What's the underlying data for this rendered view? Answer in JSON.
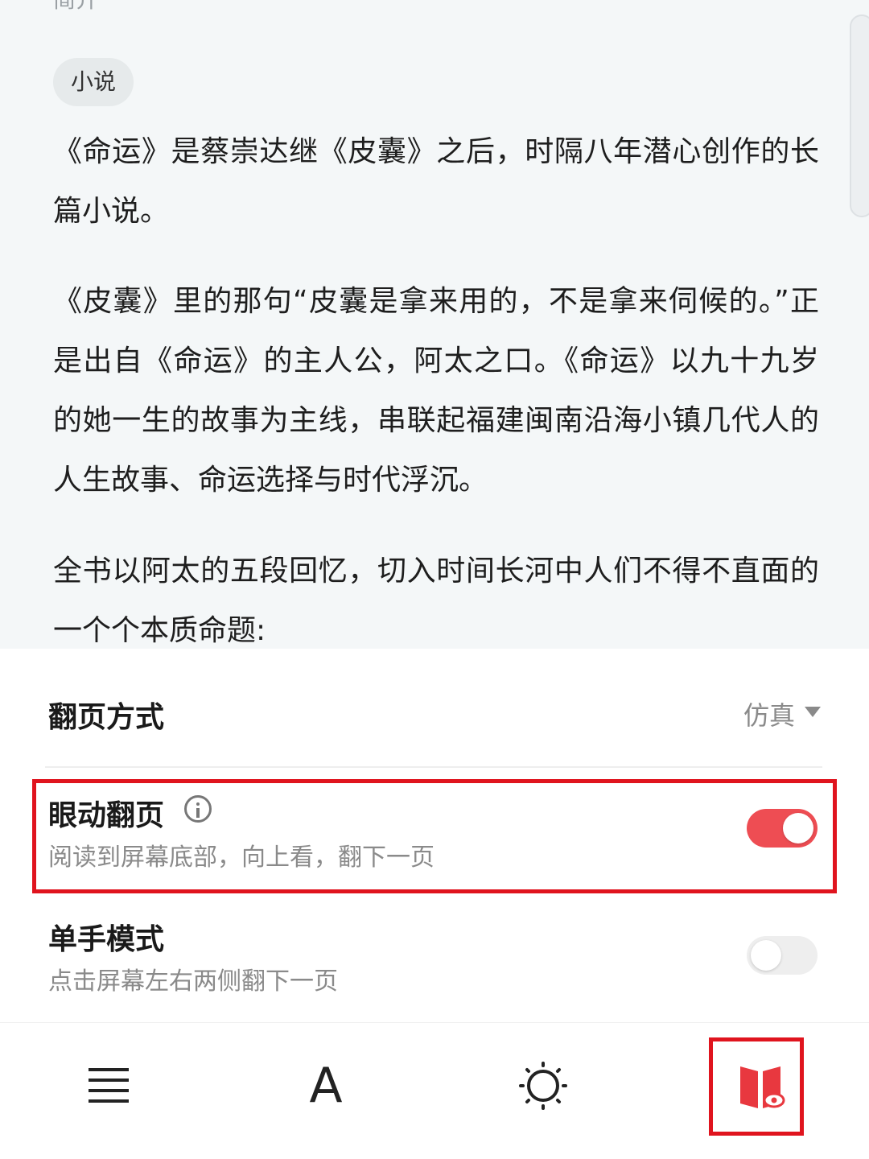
{
  "reader": {
    "cut_off_text": "简介",
    "tag": "小说",
    "paragraphs": [
      "《命运》是蔡崇达继《皮囊》之后，时隔八年潜心创作的长篇小说。",
      "《皮囊》里的那句“皮囊是拿来用的，不是拿来伺候的。”正是出自《命运》的主人公，阿太之口。《命运》以九十九岁的她一生的故事为主线，串联起福建闽南沿海小镇几代人的人生故事、命运选择与时代浮沉。",
      "全书以阿太的五段回忆，切入时间长河中人们不得不直面的一个个本质命题:"
    ]
  },
  "settings": {
    "page_turn_mode": {
      "label": "翻页方式",
      "value": "仿真"
    },
    "eye_page_turn": {
      "label": "眼动翻页",
      "description": "阅读到屏幕底部，向上看，翻下一页",
      "enabled": true
    },
    "one_hand_mode": {
      "label": "单手模式",
      "description": "点击屏幕左右两侧翻下一页",
      "enabled": false
    }
  },
  "toolbar": {
    "items": [
      {
        "icon": "menu-icon"
      },
      {
        "icon": "font-icon",
        "glyph": "A"
      },
      {
        "icon": "brightness-icon"
      },
      {
        "icon": "reading-mode-icon"
      }
    ]
  },
  "colors": {
    "accent": "#ee4d53",
    "highlight": "#e0141e",
    "reader_background": "#f4f7f8"
  }
}
